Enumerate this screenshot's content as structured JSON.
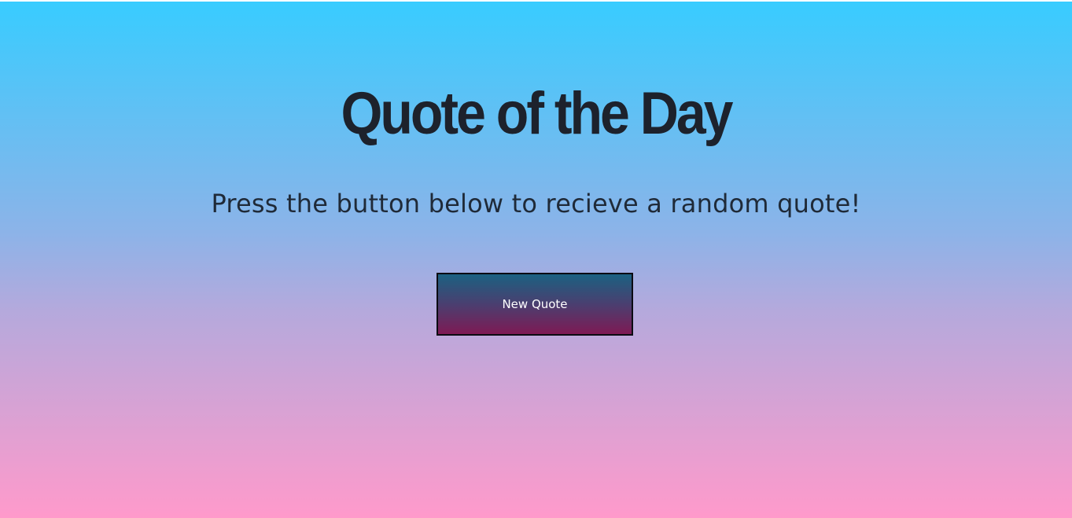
{
  "header": {
    "title": "Quote of the Day",
    "subtitle": "Press the button below to recieve a random quote!"
  },
  "actions": {
    "new_quote_label": "New Quote"
  },
  "colors": {
    "background_top": "#38ccff",
    "background_bottom": "#ff9acb",
    "text": "#1d222c",
    "button_top": "#1b6181",
    "button_bottom": "#7e1a54",
    "button_text": "#ffffff"
  }
}
